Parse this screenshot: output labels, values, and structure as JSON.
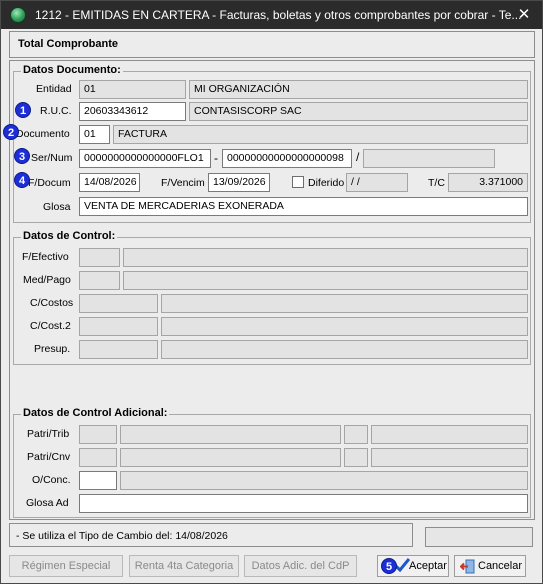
{
  "window": {
    "title": "1212 - EMITIDAS EN CARTERA - Facturas, boletas y otros comprobantes por cobrar - Te...",
    "close_glyph": "✕"
  },
  "header": {
    "total_label": "Total Comprobante"
  },
  "datos_documento": {
    "legend": "Datos Documento:",
    "entidad_label": "Entidad",
    "entidad_code": "01",
    "entidad_name": "MI ORGANIZACIÓN",
    "ruc_label": "R.U.C.",
    "ruc_value": "20603343612",
    "ruc_name": "CONTASISCORP SAC",
    "documento_label": "Documento",
    "documento_code": "01",
    "documento_name": "FACTURA",
    "sernum_label": "Ser/Num",
    "serie_value": "0000000000000000FLO1",
    "sernum_dash": "-",
    "numero_value": "00000000000000000098",
    "sernum_slash": "/",
    "fdocum_label": "F/Docum",
    "fdocum_value": "14/08/2026",
    "fvencim_label": "F/Vencim",
    "fvencim_value": "13/09/2026",
    "diferido_label": "Diferido",
    "diferido_value": "/ /",
    "tc_label": "T/C",
    "tc_value": "3.371000",
    "glosa_label": "Glosa",
    "glosa_value": "VENTA DE MERCADERIAS EXONERADA"
  },
  "datos_control": {
    "legend": "Datos de Control:",
    "fefectivo_label": "F/Efectivo",
    "medpago_label": "Med/Pago",
    "ccostos_label": "C/Costos",
    "ccost2_label": "C/Cost.2",
    "presup_label": "Presup."
  },
  "datos_control_adicional": {
    "legend": "Datos de Control Adicional:",
    "patritrib_label": "Patri/Trib",
    "patricnv_label": "Patri/Cnv",
    "oconc_label": "O/Conc.",
    "glosaad_label": "Glosa Ad"
  },
  "status": {
    "message": "- Se utiliza el Tipo de Cambio del: 14/08/2026"
  },
  "buttons": {
    "regimen": "Régimen Especial",
    "renta": "Renta 4ta Categoria",
    "datos_adic": "Datos Adic. del CdP",
    "aceptar": "Aceptar",
    "cancelar": "Cancelar"
  },
  "badges": [
    "1",
    "2",
    "3",
    "4",
    "5"
  ],
  "colors": {
    "titlebar": "#2b2b2b",
    "badge": "#1c2ed6",
    "checkmark": "#1b57c8",
    "cancel_icon": "#c0392b"
  }
}
